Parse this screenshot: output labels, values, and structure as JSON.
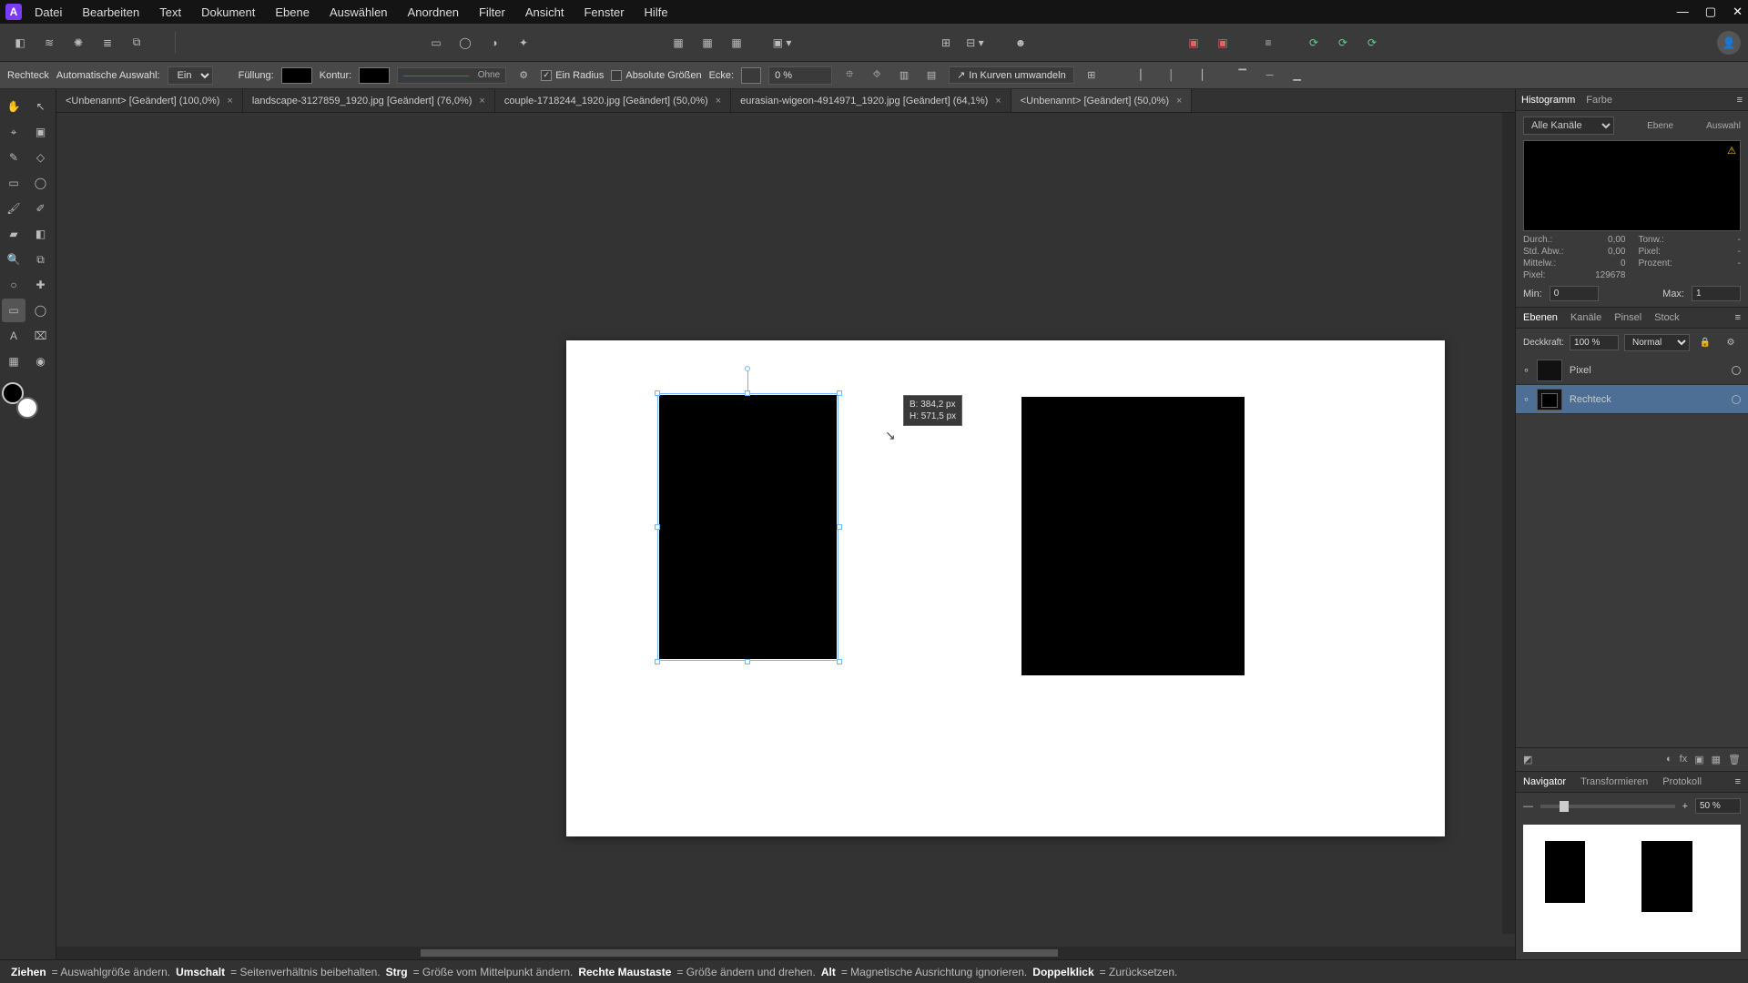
{
  "menu": {
    "items": [
      "Datei",
      "Bearbeiten",
      "Text",
      "Dokument",
      "Ebene",
      "Auswählen",
      "Anordnen",
      "Filter",
      "Ansicht",
      "Fenster",
      "Hilfe"
    ]
  },
  "context": {
    "tool_name": "Rechteck",
    "auto_select_label": "Automatische Auswahl:",
    "auto_select_value": "Ein",
    "fill_label": "Füllung:",
    "stroke_label": "Kontur:",
    "stroke_value": "Ohne",
    "single_radius_label": "Ein Radius",
    "single_radius_checked": true,
    "abs_sizes_label": "Absolute Größen",
    "abs_sizes_checked": false,
    "corner_label": "Ecke:",
    "corner_value": "0 %",
    "convert_label": "In Kurven umwandeln"
  },
  "doc_tabs": [
    {
      "label": "<Unbenannt> [Geändert] (100,0%)",
      "active": false
    },
    {
      "label": "landscape-3127859_1920.jpg [Geändert] (76,0%)",
      "active": false
    },
    {
      "label": "couple-1718244_1920.jpg [Geändert] (50,0%)",
      "active": false
    },
    {
      "label": "eurasian-wigeon-4914971_1920.jpg [Geändert] (64,1%)",
      "active": false
    },
    {
      "label": "<Unbenannt> [Geändert] (50,0%)",
      "active": true
    }
  ],
  "dimension_tip": {
    "w_label": "B:",
    "w_value": "384,2 px",
    "h_label": "H:",
    "h_value": "571,5 px"
  },
  "histogram": {
    "tab_histogram": "Histogramm",
    "tab_color": "Farbe",
    "channel_value": "Alle Kanäle",
    "scope_layer": "Ebene",
    "scope_selection": "Auswahl",
    "stats": {
      "mean_label": "Durch.:",
      "mean_value": "0,00",
      "std_label": "Std. Abw.:",
      "std_value": "0,00",
      "median_label": "Mittelw.:",
      "median_value": "0",
      "pixels_label": "Pixel:",
      "pixels_value": "129678",
      "tones_label": "Tonw.:",
      "tones_value": "-",
      "pixel2_label": "Pixel:",
      "pixel2_value": "-",
      "percent_label": "Prozent:",
      "percent_value": "-"
    },
    "min_label": "Min:",
    "min_value": "0",
    "max_label": "Max:",
    "max_value": "1"
  },
  "layers": {
    "tabs": {
      "layers": "Ebenen",
      "channels": "Kanäle",
      "brushes": "Pinsel",
      "stock": "Stock"
    },
    "opacity_label": "Deckkraft:",
    "opacity_value": "100 %",
    "blend_value": "Normal",
    "rows": [
      {
        "name": "Pixel",
        "selected": false
      },
      {
        "name": "Rechteck",
        "selected": true
      }
    ]
  },
  "navigator": {
    "tabs": {
      "navigator": "Navigator",
      "transform": "Transformieren",
      "history": "Protokoll"
    },
    "zoom_value": "50 %"
  },
  "status": {
    "drag": "Ziehen",
    "drag_desc": " = Auswahlgröße ändern. ",
    "shift": "Umschalt",
    "shift_desc": " = Seitenverhältnis beibehalten. ",
    "ctrl": "Strg",
    "ctrl_desc": " = Größe vom Mittelpunkt ändern. ",
    "rmb": "Rechte Maustaste",
    "rmb_desc": " = Größe ändern und drehen. ",
    "alt": "Alt",
    "alt_desc": " = Magnetische Ausrichtung ignorieren. ",
    "dbl": "Doppelklick",
    "dbl_desc": " = Zurücksetzen."
  }
}
